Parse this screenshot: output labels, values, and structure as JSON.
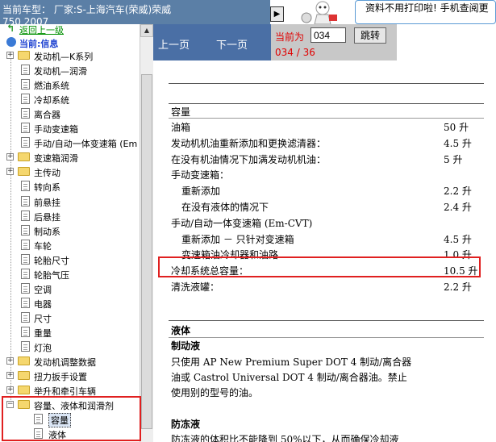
{
  "header": {
    "line1": "当前车型：  厂家:S-上海汽车(荣威)荣威",
    "line2": "750 2007",
    "banner": [
      "资料不用打印啦! 手机查阅更"
    ]
  },
  "tree": {
    "back": "返回上一级",
    "current": "当前:信息",
    "items": [
      {
        "label": "发动机—K系列",
        "type": "folder"
      },
      {
        "label": "发动机—润滑",
        "type": "doc"
      },
      {
        "label": "燃油系统",
        "type": "doc"
      },
      {
        "label": "冷却系统",
        "type": "doc"
      },
      {
        "label": "离合器",
        "type": "doc"
      },
      {
        "label": "手动变速箱",
        "type": "doc"
      },
      {
        "label": "手动/自动一体变速箱 (Em",
        "type": "doc"
      },
      {
        "label": "变速箱润滑",
        "type": "folder"
      },
      {
        "label": "主传动",
        "type": "folder"
      },
      {
        "label": "转向系",
        "type": "doc"
      },
      {
        "label": "前悬挂",
        "type": "doc"
      },
      {
        "label": "后悬挂",
        "type": "doc"
      },
      {
        "label": "制动系",
        "type": "doc"
      },
      {
        "label": "车轮",
        "type": "doc"
      },
      {
        "label": "轮胎尺寸",
        "type": "doc"
      },
      {
        "label": "轮胎气压",
        "type": "doc"
      },
      {
        "label": "空调",
        "type": "doc"
      },
      {
        "label": "电器",
        "type": "doc"
      },
      {
        "label": "尺寸",
        "type": "doc"
      },
      {
        "label": "重量",
        "type": "doc"
      },
      {
        "label": "灯泡",
        "type": "doc"
      },
      {
        "label": "发动机调整数据",
        "type": "folder"
      },
      {
        "label": "扭力扳手设置",
        "type": "folder"
      },
      {
        "label": "举升和牵引车辆",
        "type": "folder"
      },
      {
        "label": "容量、液体和润滑剂",
        "type": "open-folder"
      },
      {
        "label": "容量",
        "type": "subdoc",
        "selected": true
      },
      {
        "label": "液体",
        "type": "subdoc"
      }
    ]
  },
  "toolbar": {
    "prev": "上一页",
    "next": "下一页",
    "current_label": "当前为",
    "page_value": "034",
    "jump": "跳转",
    "page_count": "034 / 36"
  },
  "doc": {
    "section1_title": "容量",
    "rows": [
      {
        "label": "油箱",
        "value": "50 升",
        "indent": false
      },
      {
        "label": "发动机机油重新添加和更换滤清器：",
        "value": "4.5 升",
        "indent": false
      },
      {
        "label": "在没有机油情况下加满发动机机油：",
        "value": "5 升",
        "indent": false
      },
      {
        "label": "手动变速箱：",
        "value": "",
        "indent": false
      },
      {
        "label": "重新添加",
        "value": "2.2 升",
        "indent": true
      },
      {
        "label": "在没有液体的情况下",
        "value": "2.4 升",
        "indent": true
      },
      {
        "label": "手动/自动一体变速箱 (Em-CVT)",
        "value": "",
        "indent": false
      },
      {
        "label": "重新添加 － 只针对变速箱",
        "value": "4.5 升",
        "indent": true
      },
      {
        "label": "变速箱油冷却器和油路",
        "value": "1.0 升",
        "indent": true
      },
      {
        "label": "冷却系统总容量：",
        "value": "10.5 升",
        "indent": false
      },
      {
        "label": "清洗液罐：",
        "value": "2.2 升",
        "indent": false
      }
    ],
    "section2_title": "液体",
    "brake_title": "制动液",
    "brake_text": [
      "只使用 AP New Premium Super DOT 4 制动/离合器",
      "油或 Castrol Universal DOT 4 制动/离合器油。禁止",
      "使用别的型号的油。"
    ],
    "antifreeze_title": "防冻液",
    "antifreeze_text": "防冻液的体积比不能降到 50%以下，从而确保冷却液"
  },
  "colors": {
    "header": "#5b7fa6",
    "toolbar": "#4a6fa5",
    "highlight": "#e02020",
    "page_text": "#e00000"
  }
}
